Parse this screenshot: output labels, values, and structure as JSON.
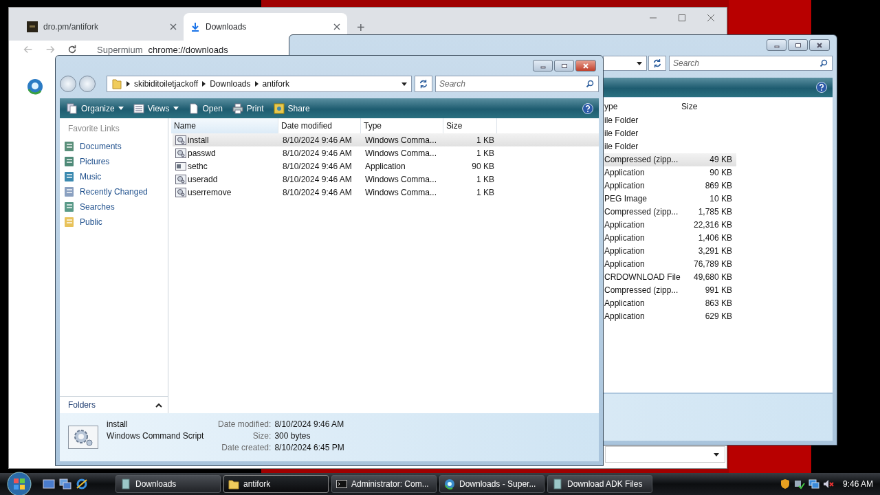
{
  "browser": {
    "tabs": [
      {
        "title": "dro.pm/antifork",
        "kind": "site",
        "selected": false
      },
      {
        "title": "Downloads",
        "kind": "download",
        "selected": true
      }
    ],
    "new_tab": "+",
    "address": {
      "site": "Supermium",
      "url": "chrome://downloads"
    }
  },
  "back_explorer": {
    "search": {
      "placeholder": "Search"
    },
    "columns": [
      "ype",
      "Size"
    ],
    "rows": [
      {
        "type": "ile Folder",
        "selected": false
      },
      {
        "type": "ile Folder",
        "selected": false
      },
      {
        "type": "ile Folder",
        "selected": false
      },
      {
        "type": "Compressed (zipp...",
        "size": "49 KB",
        "selected": true
      },
      {
        "type": "Application",
        "size": "90 KB",
        "selected": false
      },
      {
        "type": "Application",
        "size": "869 KB",
        "selected": false
      },
      {
        "type": "PEG Image",
        "size": "10 KB",
        "selected": false
      },
      {
        "type": "Compressed (zipp...",
        "size": "1,785 KB",
        "selected": false
      },
      {
        "type": "Application",
        "size": "22,316 KB",
        "selected": false
      },
      {
        "type": "Application",
        "size": "1,406 KB",
        "selected": false
      },
      {
        "type": "Application",
        "size": "3,291 KB",
        "selected": false
      },
      {
        "type": "Application",
        "size": "76,789 KB",
        "selected": false
      },
      {
        "type": "CRDOWNLOAD File",
        "size": "49,680 KB",
        "selected": false
      },
      {
        "type": "Compressed (zipp...",
        "size": "991 KB",
        "selected": false
      },
      {
        "type": "Application",
        "size": "863 KB",
        "selected": false
      },
      {
        "type": "Application",
        "size": "629 KB",
        "selected": false
      }
    ]
  },
  "explorer": {
    "breadcrumb": [
      "skibiditoiletjackoff",
      "Downloads",
      "antifork"
    ],
    "search": {
      "placeholder": "Search"
    },
    "toolbar": [
      {
        "label": "Organize",
        "kind": "organize",
        "dropdown": true
      },
      {
        "label": "Views",
        "kind": "views",
        "dropdown": true
      },
      {
        "label": "Open",
        "kind": "open",
        "dropdown": false
      },
      {
        "label": "Print",
        "kind": "print",
        "dropdown": false
      },
      {
        "label": "Share",
        "kind": "share",
        "dropdown": false
      }
    ],
    "favorite_links": {
      "title": "Favorite Links",
      "items": [
        {
          "label": "Documents",
          "kind": "documents"
        },
        {
          "label": "Pictures",
          "kind": "pictures"
        },
        {
          "label": "Music",
          "kind": "music"
        },
        {
          "label": "Recently Changed",
          "kind": "recent"
        },
        {
          "label": "Searches",
          "kind": "searches"
        },
        {
          "label": "Public",
          "kind": "folder"
        }
      ]
    },
    "folders": "Folders",
    "columns": [
      "Name",
      "Date modified",
      "Type",
      "Size"
    ],
    "rows": [
      {
        "name": "install",
        "date": "8/10/2024 9:46 AM",
        "type": "Windows Comma...",
        "size": "1 KB",
        "kind": "script",
        "selected": true
      },
      {
        "name": "passwd",
        "date": "8/10/2024 9:46 AM",
        "type": "Windows Comma...",
        "size": "1 KB",
        "kind": "script",
        "selected": false
      },
      {
        "name": "sethc",
        "date": "8/10/2024 9:46 AM",
        "type": "Application",
        "size": "90 KB",
        "kind": "app",
        "selected": false
      },
      {
        "name": "useradd",
        "date": "8/10/2024 9:46 AM",
        "type": "Windows Comma...",
        "size": "1 KB",
        "kind": "script",
        "selected": false
      },
      {
        "name": "userremove",
        "date": "8/10/2024 9:46 AM",
        "type": "Windows Comma...",
        "size": "1 KB",
        "kind": "script",
        "selected": false
      }
    ],
    "details": {
      "name": "install",
      "type": "Windows Command Script",
      "fields": [
        {
          "label": "Date modified:",
          "value": "8/10/2024 9:46 AM"
        },
        {
          "label": "Size:",
          "value": "300 bytes"
        },
        {
          "label": "Date created:",
          "value": "8/10/2024 6:45 PM"
        }
      ]
    }
  },
  "taskbar": {
    "buttons": [
      {
        "label": "Downloads",
        "kind": "explorer",
        "selected": false
      },
      {
        "label": "antifork",
        "kind": "folder",
        "selected": true
      },
      {
        "label": "Administrator: Com...",
        "kind": "console",
        "selected": false
      },
      {
        "label": "Downloads - Super...",
        "kind": "browser",
        "selected": false
      },
      {
        "label": "Download ADK Files",
        "kind": "explorer",
        "selected": false
      }
    ],
    "clock": "9:46 AM"
  }
}
